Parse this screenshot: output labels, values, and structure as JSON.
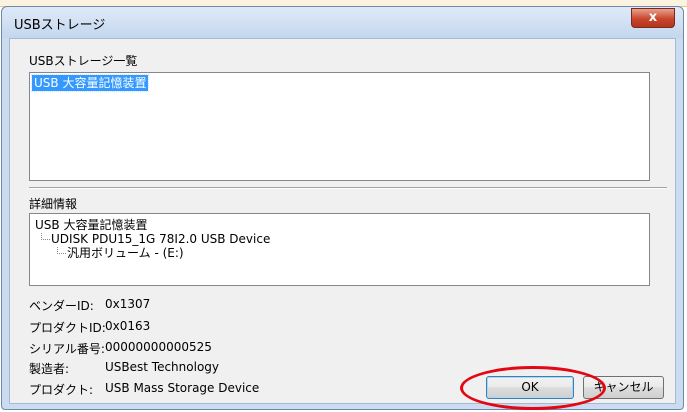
{
  "window": {
    "title": "USBストレージ",
    "close_glyph": "x"
  },
  "storage_list": {
    "label": "USBストレージ一覧",
    "items": [
      "USB 大容量記憶装置"
    ],
    "selected_index": 0
  },
  "details": {
    "label": "詳細情報",
    "tree": {
      "root": "USB 大容量記憶装置",
      "child": "UDISK PDU15_1G 78I2.0 USB Device",
      "grandchild": "汎用ボリューム - (E:)"
    }
  },
  "info": [
    {
      "label": "ベンダーID:",
      "value": "0x1307"
    },
    {
      "label": "プロダクトID:",
      "value": "0x0163"
    },
    {
      "label": "シリアル番号:",
      "value": "00000000000525"
    },
    {
      "label": "製造者:",
      "value": "USBest Technology"
    },
    {
      "label": "プロダクト:",
      "value": "USB Mass Storage Device"
    }
  ],
  "buttons": {
    "ok": "OK",
    "cancel": "キャンセル"
  },
  "colors": {
    "selection": "#3399ff",
    "annotation": "#e30613",
    "close_button": "#c8462c"
  }
}
